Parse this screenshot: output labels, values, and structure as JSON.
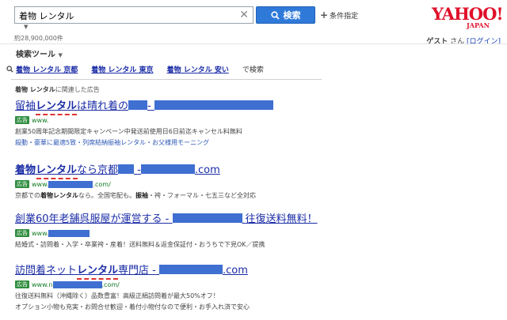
{
  "search": {
    "query": "着物 レンタル",
    "button_label": "検索",
    "advanced_label": "条件指定",
    "result_count": "約28,900,000件"
  },
  "logo": {
    "main": "YAHOO!",
    "sub": "JAPAN"
  },
  "user": {
    "name": "ゲスト",
    "honorific": "さん",
    "login": "[ログイン]"
  },
  "tools": {
    "label": "検索ツール"
  },
  "related": {
    "items": [
      "着物 レンタル 京都",
      "着物 レンタル 東京",
      "着物 レンタル 安い"
    ],
    "suffix": "で検索"
  },
  "ads_header": {
    "keyword": "着物 レンタル",
    "suffix": "に関連した広告"
  },
  "ads": [
    {
      "title_pre": "留袖",
      "title_kw": "レンタル",
      "title_post": "は晴れ着の",
      "title_tail": "-",
      "url_prefix": "www.",
      "badge": "広告",
      "desc": "創業50周年記念期間限定キャンペーン中発送前使用日6日前迄キャンセル料無料",
      "sitelinks": "殺動・豪華に最適5致・列席結納振袖レンタル・お父様用モーニング"
    },
    {
      "title_pre": "着物",
      "title_kw": "レンタル",
      "title_post": "なら京都",
      "title_mid": "-",
      "title_tail": ".com",
      "url_prefix": "www.",
      "url_suffix": ".com/",
      "badge": "広告",
      "desc_pre": "京都での",
      "desc_kw": "着物レンタル",
      "desc_mid": "なら。全国宅配も。",
      "desc_kw2": "振袖",
      "desc_post": "・袴・フォーマル・七五三など全対応"
    },
    {
      "title_pre": "創業60年老舗呉服屋が運営する -",
      "title_post": "往復送料無料！",
      "url_prefix": "www.",
      "badge": "広告",
      "desc": "結婚式・訪問着・入学・卒業袴・産着！送料無料＆返金保証付・おうちで下見OK／提携"
    },
    {
      "title_pre": "訪問着ネット",
      "title_kw": "レンタル",
      "title_post": "専門店 -",
      "title_tail": ".com",
      "url_prefix": "www.n",
      "url_suffix": ".com/",
      "badge": "広告",
      "desc": "往復送料無料（沖縄除く）品数豊富！高級正絹訪問着が最大50%オフ！",
      "desc2": "オプション小物も充実・お問合せ歓迎・着付小物付なので便利・お手入れ済で安心"
    }
  ],
  "colors": {
    "accent": "#2f7ad9",
    "link": "#1a2ca6",
    "url_green": "#137b25",
    "logo_red": "#e0102a"
  }
}
